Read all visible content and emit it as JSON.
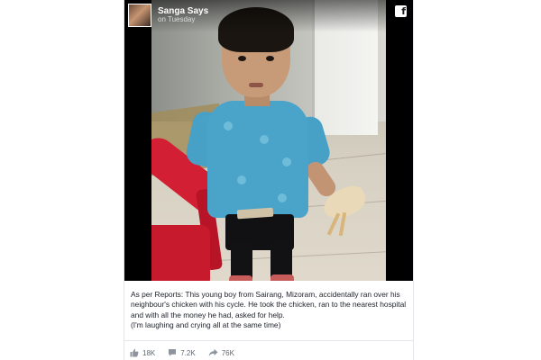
{
  "post": {
    "page_name": "Sanga Says",
    "time": "on Tuesday",
    "network_icon": "facebook-icon",
    "network_glyph": "f",
    "caption_lines": [
      "As per Reports: This young boy from Sairang, Mizoram, accidentally ran over his neighbour's chicken with his cycle. He took the chicken, ran to the nearest hospital and with all the money he had, asked for help.",
      "(I'm laughing and crying all at the same time)"
    ],
    "stats": {
      "likes": "18K",
      "comments": "7.2K",
      "shares": "76K"
    }
  },
  "colors": {
    "brand_text": "#1d2129",
    "muted": "#606770",
    "media_bg": "#000000"
  }
}
